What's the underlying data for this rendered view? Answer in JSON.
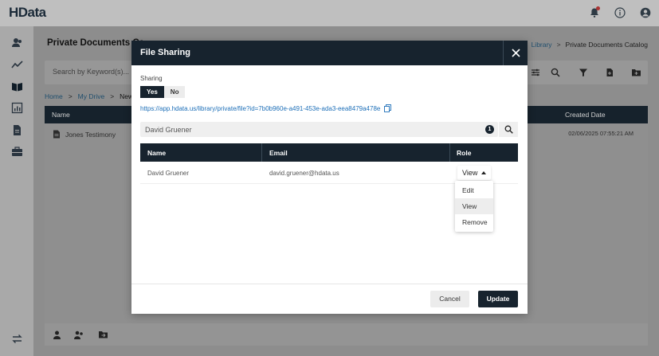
{
  "app": {
    "logo": "HData"
  },
  "background": {
    "page_title": "Private Documents Catalog",
    "breadcrumb_right": {
      "library": "Library",
      "current": "Private Documents Catalog"
    },
    "search_placeholder": "Search by Keyword(s)...",
    "breadcrumb_left": {
      "home": "Home",
      "my_drive": "My Drive",
      "current": "New"
    },
    "table": {
      "col_name": "Name",
      "col_created": "Created Date",
      "row": {
        "name": "Jones Testimony",
        "created": "02/06/2025 07:55:21 AM"
      }
    }
  },
  "modal": {
    "title": "File Sharing",
    "sharing_label": "Sharing",
    "toggle": {
      "yes": "Yes",
      "no": "No",
      "selected": "Yes"
    },
    "share_link": "https://app.hdata.us/library/private/file?id=7b0b960e-a491-453e-ada3-eea8479a478e",
    "user_search": {
      "value": "David Gruener",
      "count": "1"
    },
    "table": {
      "headers": {
        "name": "Name",
        "email": "Email",
        "role": "Role"
      },
      "rows": [
        {
          "name": "David Gruener",
          "email": "david.gruener@hdata.us",
          "role": "View"
        }
      ]
    },
    "role_menu": {
      "options": [
        "Edit",
        "View",
        "Remove"
      ],
      "selected": "View"
    },
    "buttons": {
      "cancel": "Cancel",
      "update": "Update"
    }
  },
  "colors": {
    "header_dark": "#17232e",
    "link_blue": "#1d6fb8",
    "notification": "#a33333"
  }
}
